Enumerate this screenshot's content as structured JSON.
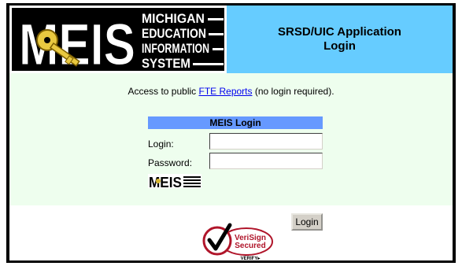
{
  "header": {
    "logo_letters": "MEIS",
    "logo_words": [
      "MICHIGAN",
      "EDUCATION",
      "INFORMATION",
      "SYSTEM"
    ],
    "title_line1": "SRSD/UIC Application",
    "title_line2": "Login"
  },
  "access": {
    "prefix": "Access to public ",
    "link": "FTE Reports",
    "suffix": " (no login required)."
  },
  "login_form": {
    "title": "MEIS Login",
    "login_label": "Login:",
    "login_value": "",
    "password_label": "Password:",
    "password_value": "",
    "button_label": "Login",
    "mini_logo": "MEIS"
  },
  "badge": {
    "line1": "VeriSign",
    "line2": "Secured",
    "verify": "VERIFY▸"
  },
  "colors": {
    "title_bg": "#66ccff",
    "content_bg": "#eefeee",
    "login_header": "#6699ff",
    "verisign_red": "#b0152a"
  }
}
